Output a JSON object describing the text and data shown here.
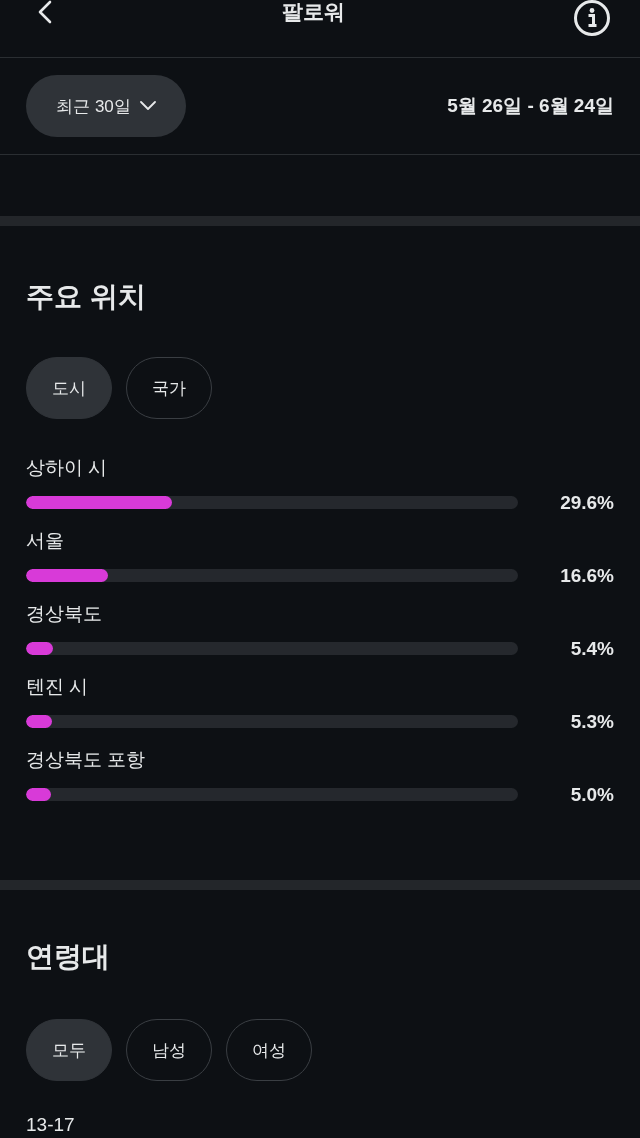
{
  "header": {
    "title": "팔로워"
  },
  "filter": {
    "period": "최근 30일",
    "date_range": "5월 26일 - 6월 24일"
  },
  "sections": [
    {
      "title": "주요 위치",
      "tabs": [
        {
          "label": "도시",
          "selected": true
        },
        {
          "label": "국가",
          "selected": false
        }
      ],
      "rows": [
        {
          "name": "상하이 시",
          "level": 0.296,
          "reading": "29.6%"
        },
        {
          "name": "서울",
          "level": 0.166,
          "reading": "16.6%"
        },
        {
          "name": "경상북도",
          "level": 0.054,
          "reading": "5.4%"
        },
        {
          "name": "텐진 시",
          "level": 0.053,
          "reading": "5.3%"
        },
        {
          "name": "경상북도 포항",
          "level": 0.05,
          "reading": "5.0%"
        }
      ]
    },
    {
      "title": "연령대",
      "tabs": [
        {
          "label": "모두",
          "selected": true
        },
        {
          "label": "남성",
          "selected": false
        },
        {
          "label": "여성",
          "selected": false
        }
      ],
      "rows": [
        {
          "name": "13-17"
        }
      ]
    }
  ]
}
